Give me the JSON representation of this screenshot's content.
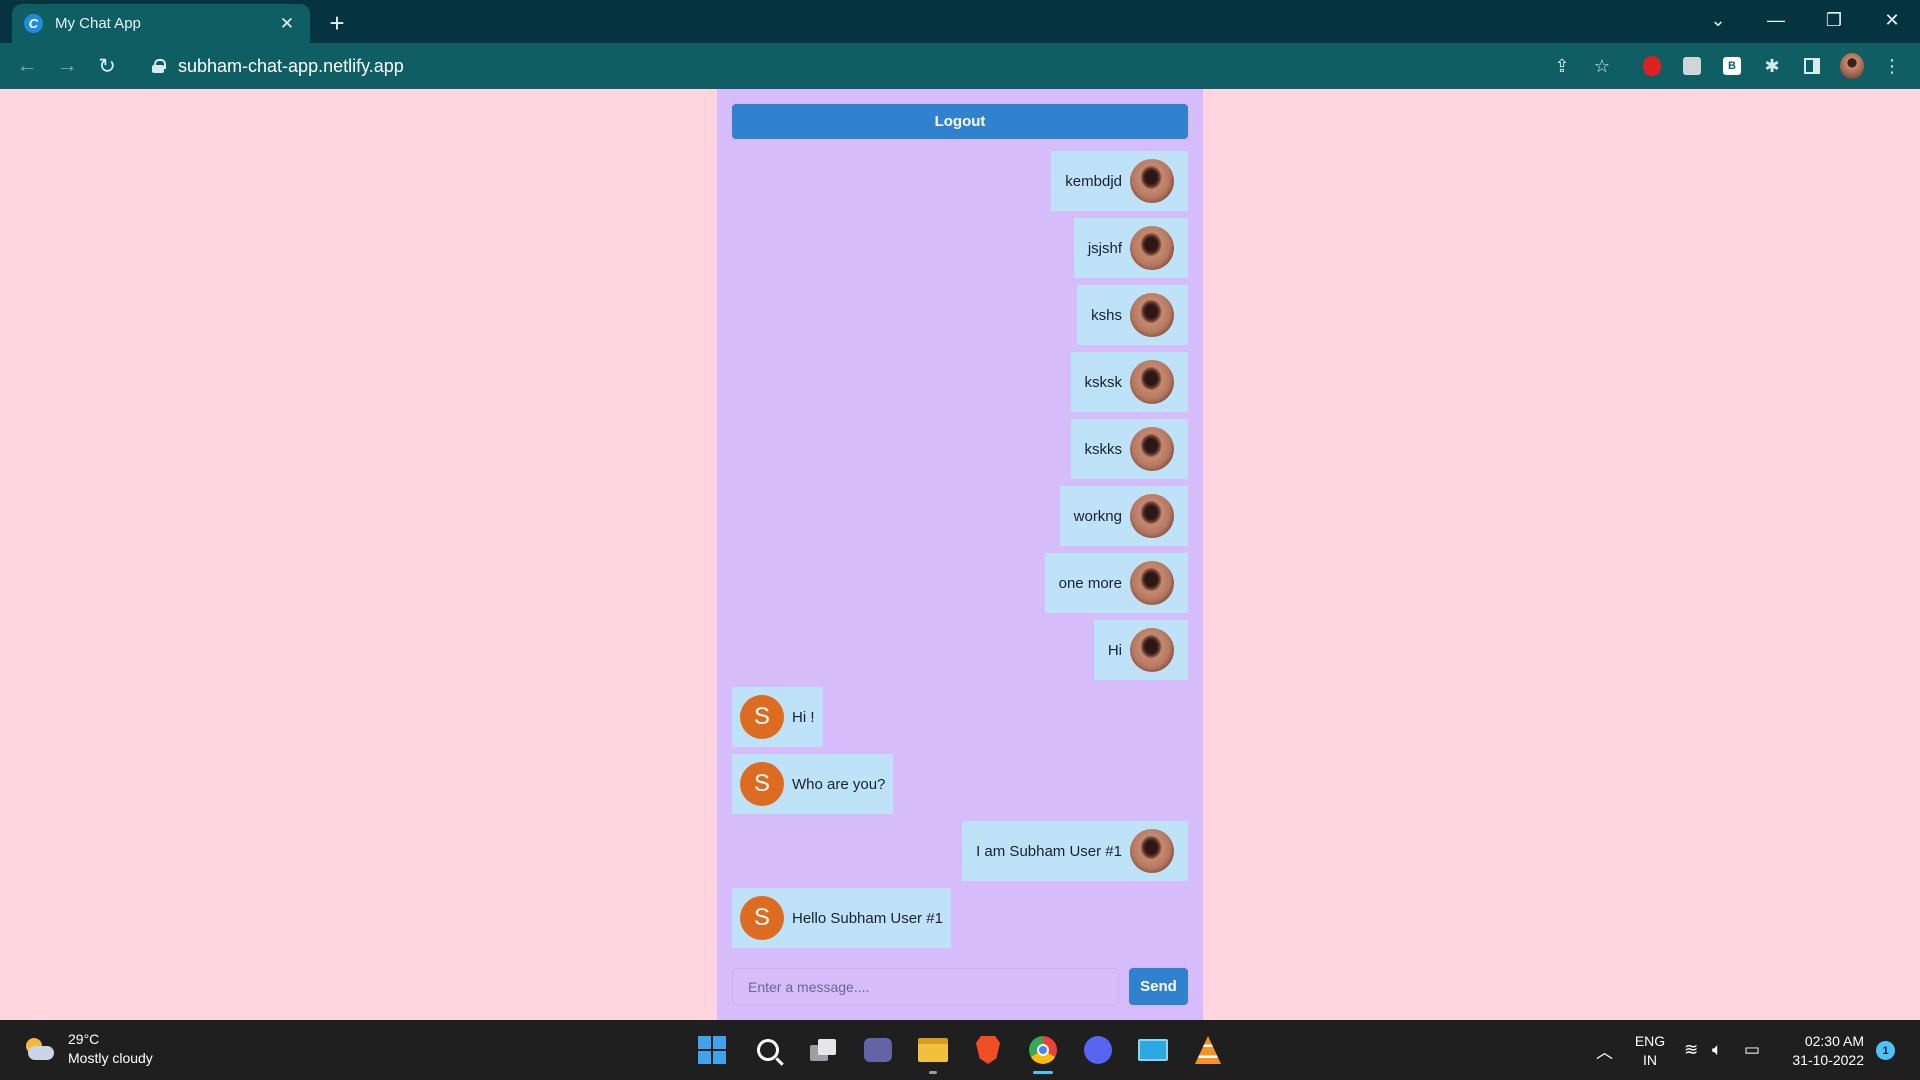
{
  "browser": {
    "tab_title": "My Chat App",
    "tab_favicon_letter": "C",
    "url": "subham-chat-app.netlify.app",
    "accent_color": "#0e5e63"
  },
  "app": {
    "logout_label": "Logout",
    "messages": [
      {
        "text": "kembdjd",
        "from": "me"
      },
      {
        "text": "jsjshf",
        "from": "me"
      },
      {
        "text": "kshs",
        "from": "me"
      },
      {
        "text": "ksksk",
        "from": "me"
      },
      {
        "text": "kskks",
        "from": "me"
      },
      {
        "text": "workng",
        "from": "me"
      },
      {
        "text": "one more",
        "from": "me"
      },
      {
        "text": "Hi",
        "from": "me"
      },
      {
        "text": "Hi !",
        "from": "other",
        "initial": "S"
      },
      {
        "text": "Who are you?",
        "from": "other",
        "initial": "S"
      },
      {
        "text": "I am Subham User #1",
        "from": "me"
      },
      {
        "text": "Hello Subham User #1",
        "from": "other",
        "initial": "S"
      }
    ],
    "composer": {
      "placeholder": "Enter a message....",
      "value": "",
      "send_label": "Send"
    },
    "colors": {
      "page_bg": "#ffd6e0",
      "panel_bg": "#d6bcfa",
      "bubble_bg": "#bee3f8",
      "button_bg": "#3182ce",
      "avatar_letter_bg": "#dd6b20"
    }
  },
  "taskbar": {
    "weather_temp": "29°C",
    "weather_desc": "Mostly cloudy",
    "lang_top": "ENG",
    "lang_bottom": "IN",
    "time": "02:30 AM",
    "date": "31-10-2022",
    "notification_count": "1",
    "apps": [
      "start-icon",
      "search-icon",
      "task-view-icon",
      "teams-icon",
      "file-explorer-icon",
      "brave-icon",
      "chrome-icon",
      "discord-icon",
      "remote-desktop-icon",
      "vlc-icon"
    ]
  }
}
